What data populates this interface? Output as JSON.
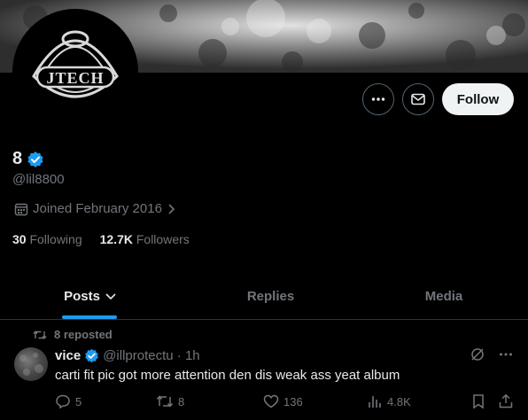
{
  "profile": {
    "display_name": "8",
    "handle": "@lil8800",
    "joined": "Joined February 2016",
    "following_count": "30",
    "following_label": "Following",
    "followers_count": "12.7K",
    "followers_label": "Followers",
    "verified": true
  },
  "actions": {
    "more_icon": "more-icon",
    "message_icon": "mail-icon",
    "follow_label": "Follow"
  },
  "tabs": [
    {
      "label": "Posts",
      "active": true
    },
    {
      "label": "Replies",
      "active": false
    },
    {
      "label": "Media",
      "active": false
    }
  ],
  "post": {
    "repost_label": "8 reposted",
    "author": "vice",
    "handle_time": "@illprotectu · 1h",
    "text": "carti fit pic got more attention den dis weak ass yeat album",
    "replies": "5",
    "reposts": "8",
    "likes": "136",
    "views": "4.8K"
  },
  "colors": {
    "accent": "#1d9bf0",
    "background": "#000000",
    "muted_text": "#71767b",
    "primary_text": "#e7e9ea"
  }
}
